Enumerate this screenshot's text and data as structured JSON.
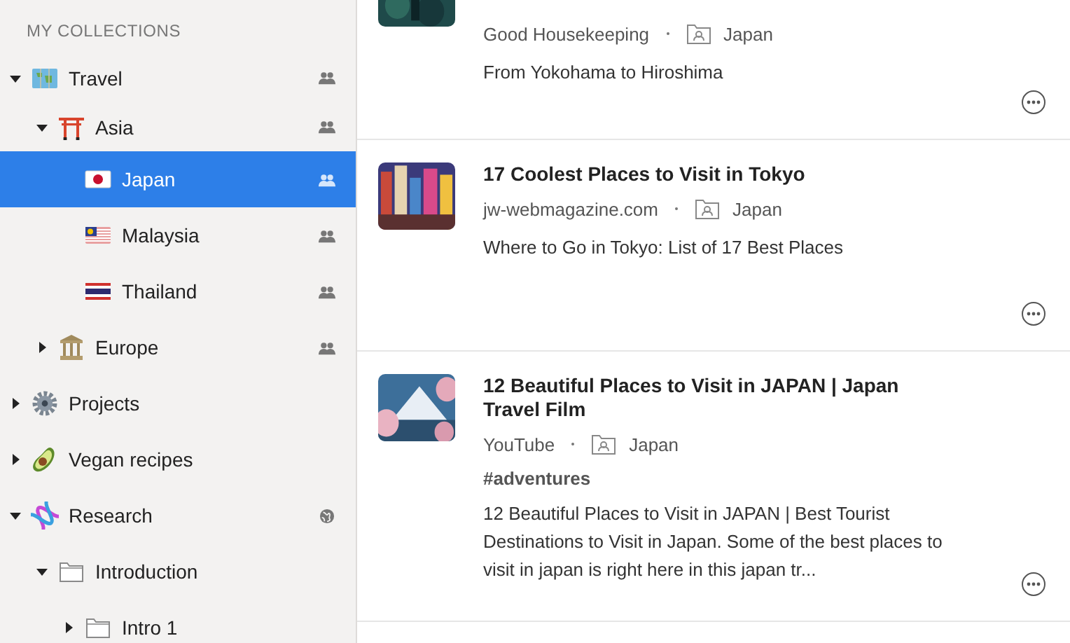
{
  "sidebar": {
    "heading": "MY COLLECTIONS",
    "items": [
      {
        "label": "Travel",
        "kind": "map",
        "shared": true,
        "public": false,
        "expanded": true,
        "selected": false,
        "children": [
          {
            "label": "Asia",
            "kind": "torii",
            "shared": true,
            "public": false,
            "expanded": true,
            "selected": false,
            "children": [
              {
                "label": "Japan",
                "kind": "flag-jp",
                "shared": true,
                "public": false,
                "selected": true
              },
              {
                "label": "Malaysia",
                "kind": "flag-my",
                "shared": true,
                "public": false,
                "selected": false
              },
              {
                "label": "Thailand",
                "kind": "flag-th",
                "shared": true,
                "public": false,
                "selected": false
              }
            ]
          },
          {
            "label": "Europe",
            "kind": "temple",
            "shared": true,
            "public": false,
            "expanded": false,
            "selected": false
          }
        ]
      },
      {
        "label": "Projects",
        "kind": "gear",
        "shared": false,
        "public": false,
        "expanded": false,
        "selected": false
      },
      {
        "label": "Vegan recipes",
        "kind": "avocado",
        "shared": false,
        "public": false,
        "expanded": false,
        "selected": false
      },
      {
        "label": "Research",
        "kind": "dna",
        "shared": false,
        "public": true,
        "expanded": true,
        "selected": false,
        "children": [
          {
            "label": "Introduction",
            "kind": "folder",
            "shared": false,
            "public": false,
            "expanded": true,
            "selected": false,
            "children": [
              {
                "label": "Intro 1",
                "kind": "folder",
                "shared": false,
                "public": false,
                "expanded": false,
                "selected": false
              }
            ]
          }
        ]
      }
    ]
  },
  "bookmarks": [
    {
      "cut": true,
      "source": "Good Housekeeping",
      "collection": "Japan",
      "description": "From Yokohama to Hiroshima"
    },
    {
      "cut": false,
      "title": "17 Coolest Places to Visit in Tokyo",
      "source": "jw-webmagazine.com",
      "collection": "Japan",
      "description": "Where to Go in Tokyo: List of 17 Best Places"
    },
    {
      "cut": false,
      "title": "12 Beautiful Places to Visit in JAPAN | Japan Travel Film",
      "source": "YouTube",
      "collection": "Japan",
      "tag": "#adventures",
      "description": "12 Beautiful Places to Visit in JAPAN | Best Tourist Destinations to Visit in Japan. Some of the best places to visit in japan is right here in this japan tr..."
    }
  ]
}
